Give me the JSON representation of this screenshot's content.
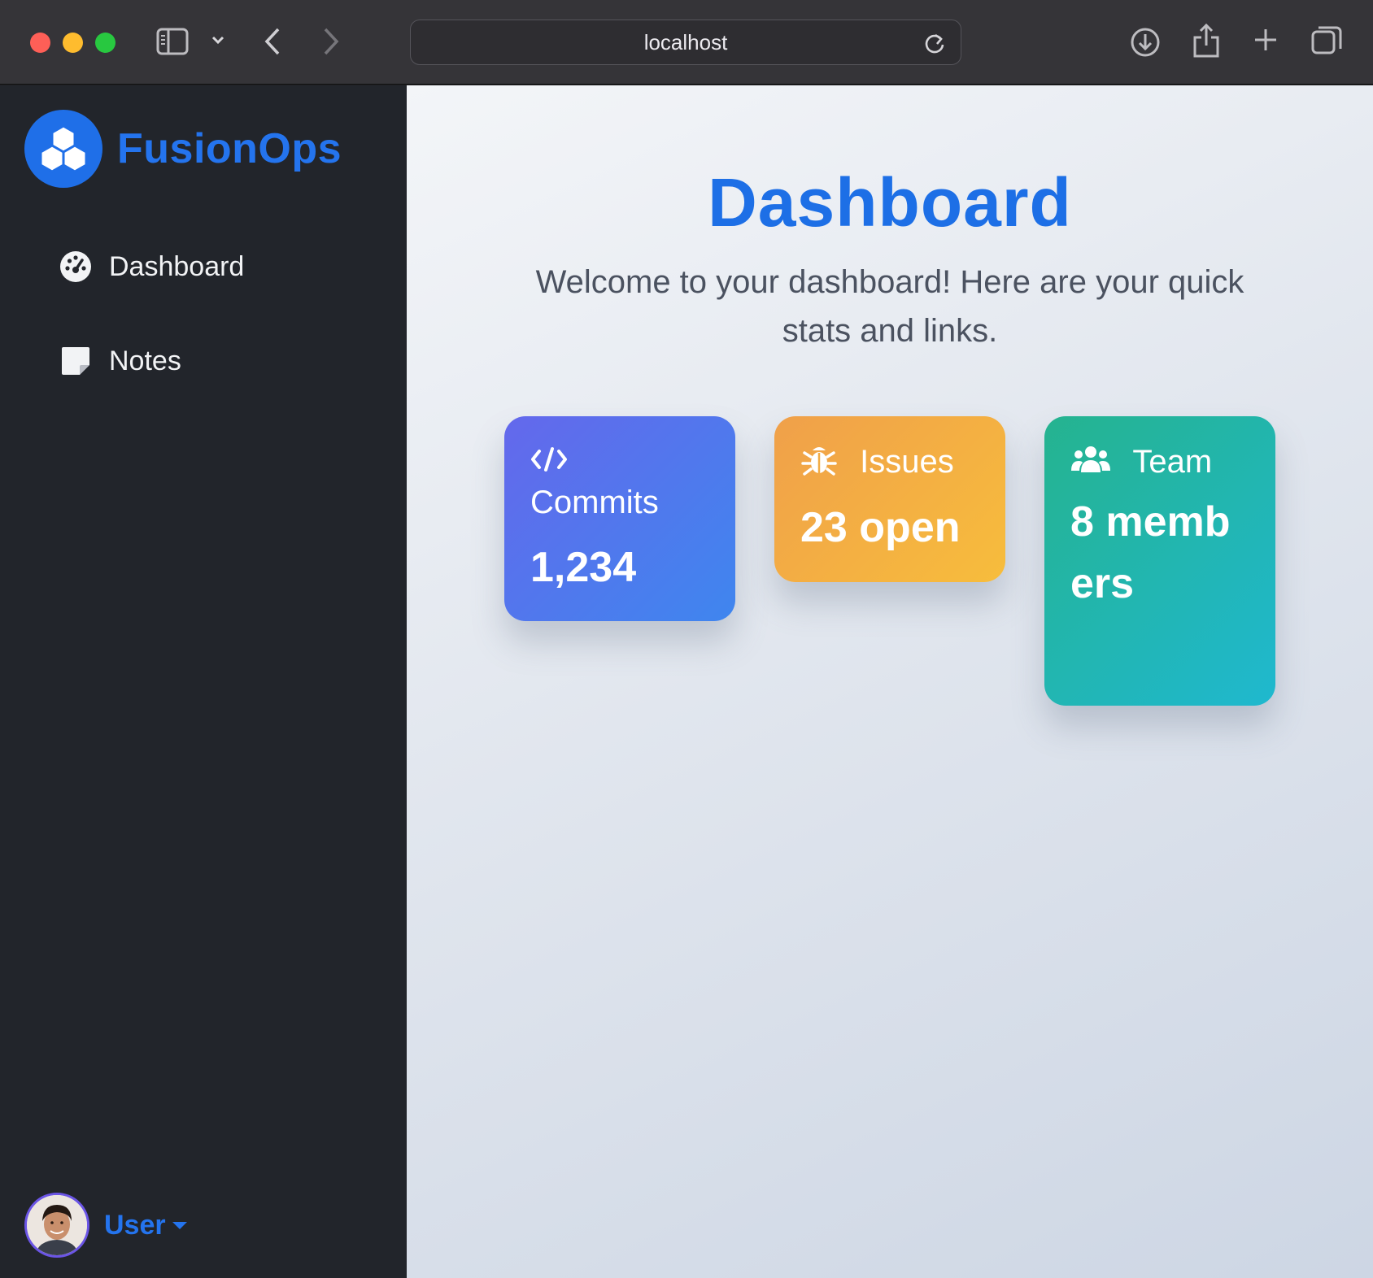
{
  "browser": {
    "url": "localhost"
  },
  "brand": {
    "name": "FusionOps",
    "color": "#2474ee"
  },
  "sidebar": {
    "items": [
      {
        "label": "Dashboard",
        "icon": "gauge-icon"
      },
      {
        "label": "Notes",
        "icon": "sticky-note-icon"
      }
    ]
  },
  "user": {
    "label": "User"
  },
  "main": {
    "title": "Dashboard",
    "subtitle": "Welcome to your dashboard! Here are your quick stats and links."
  },
  "cards": [
    {
      "label": "Commits",
      "value": "1,234",
      "icon": "code-icon",
      "colors": [
        "#6468ec",
        "#3f86ee"
      ]
    },
    {
      "label": "Issues",
      "value": "23 open",
      "icon": "bug-icon",
      "colors": [
        "#f0a04a",
        "#f7bd3c"
      ]
    },
    {
      "label": "Team",
      "value": "8 members",
      "icon": "users-icon",
      "colors": [
        "#25b38f",
        "#1fb8cf"
      ]
    }
  ]
}
